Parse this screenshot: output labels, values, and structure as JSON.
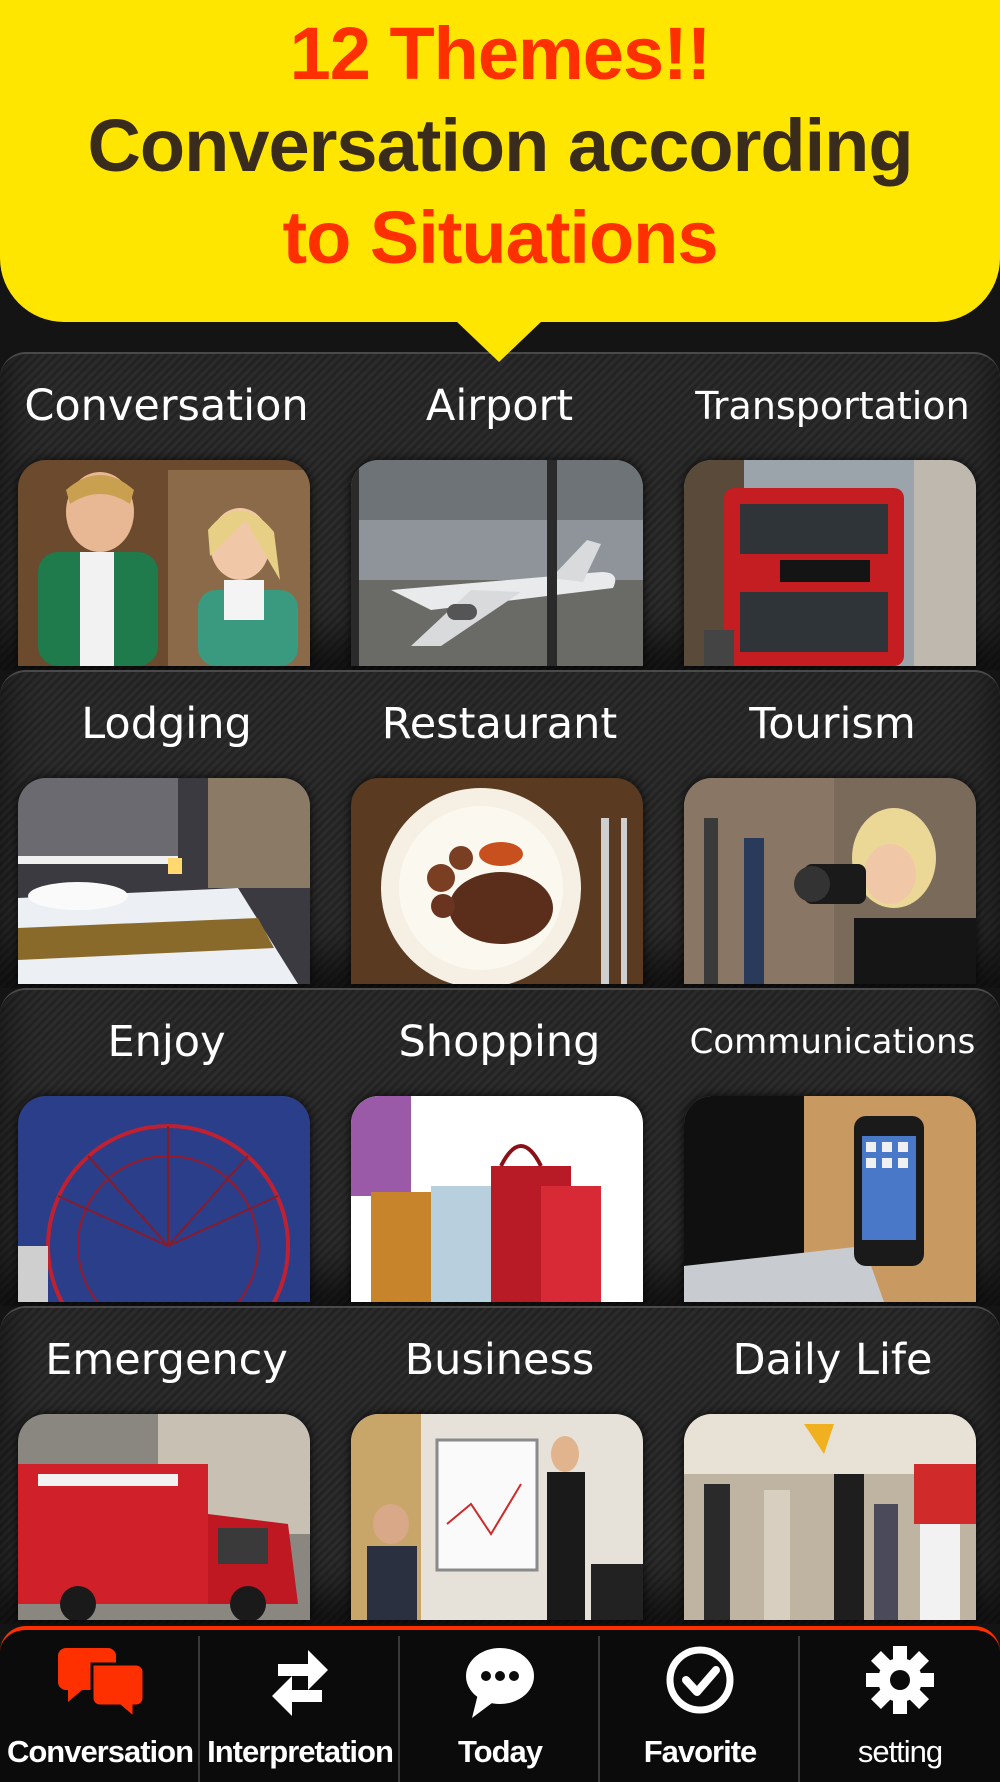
{
  "banner": {
    "line1": "12 Themes!!",
    "line2": "Conversation according",
    "line3": "to Situations"
  },
  "colors": {
    "accent": "#ff3000",
    "banner": "#ffe600",
    "headline_dark": "#3a2c1c",
    "background": "#141414"
  },
  "themes": [
    {
      "label": "Conversation",
      "image": "couple-talking"
    },
    {
      "label": "Airport",
      "image": "airplane-at-gate"
    },
    {
      "label": "Transportation",
      "image": "red-double-decker-bus"
    },
    {
      "label": "Lodging",
      "image": "hotel-bed"
    },
    {
      "label": "Restaurant",
      "image": "steak-plate"
    },
    {
      "label": "Tourism",
      "image": "woman-with-camera"
    },
    {
      "label": "Enjoy",
      "image": "ferris-wheel"
    },
    {
      "label": "Shopping",
      "image": "shopping-bags"
    },
    {
      "label": "Communications",
      "image": "smartphone-laptop"
    },
    {
      "label": "Emergency",
      "image": "ambulance"
    },
    {
      "label": "Business",
      "image": "presentation-meeting"
    },
    {
      "label": "Daily Life",
      "image": "people-walking"
    }
  ],
  "tabbar": {
    "items": [
      {
        "label": "Conversation",
        "icon": "chat-bubbles-icon",
        "active": true
      },
      {
        "label": "Interpretation",
        "icon": "swap-arrows-icon",
        "active": false
      },
      {
        "label": "Today",
        "icon": "speech-bubble-icon",
        "active": false
      },
      {
        "label": "Favorite",
        "icon": "check-circle-icon",
        "active": false
      },
      {
        "label": "setting",
        "icon": "gear-icon",
        "active": false
      }
    ]
  }
}
